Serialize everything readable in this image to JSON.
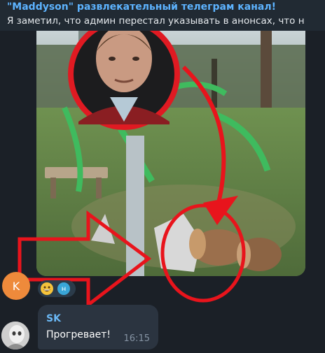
{
  "reply": {
    "title": "\"Maddyson\" развлекательный телеграм канал!",
    "preview": "Я заметил, что админ перестал указывать в анонсах, что н"
  },
  "first_message": {
    "avatar_letter": "K",
    "avatar_color": "#ee8a3b",
    "reactions": {
      "emoji": "grinning-face",
      "reactor_letter": "н"
    }
  },
  "second_message": {
    "sender": "SK",
    "text": "Прогревает!",
    "time": "16:15"
  },
  "colors": {
    "background": "#1b2027",
    "bubble": "#2b3440",
    "accent": "#5db3ff",
    "annotation_red": "#e8141c"
  },
  "icons": [
    "grinning-face-emoji",
    "avatar-k",
    "avatar-sk"
  ]
}
